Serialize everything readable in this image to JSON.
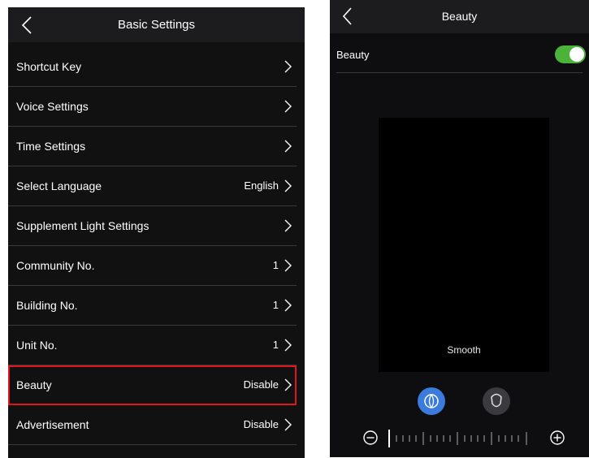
{
  "left_screen": {
    "header": {
      "title": "Basic Settings"
    },
    "items": [
      {
        "label": "Shortcut Key",
        "value": ""
      },
      {
        "label": "Voice Settings",
        "value": ""
      },
      {
        "label": "Time Settings",
        "value": ""
      },
      {
        "label": "Select Language",
        "value": "English"
      },
      {
        "label": "Supplement Light Settings",
        "value": ""
      },
      {
        "label": "Community No.",
        "value": "1"
      },
      {
        "label": "Building No.",
        "value": "1"
      },
      {
        "label": "Unit No.",
        "value": "1"
      },
      {
        "label": "Beauty",
        "value": "Disable",
        "highlighted": true
      },
      {
        "label": "Advertisement",
        "value": "Disable"
      }
    ]
  },
  "right_screen": {
    "header": {
      "title": "Beauty"
    },
    "toggle": {
      "label": "Beauty",
      "state": "on"
    },
    "preview": {
      "caption": "Smooth"
    },
    "modes": [
      {
        "icon": "smooth-mode-icon",
        "selected": true
      },
      {
        "icon": "face-shape-icon",
        "selected": false
      }
    ],
    "slider": {
      "level": 0.0
    }
  },
  "colors": {
    "background": "#111112",
    "header": "#1c1c1f",
    "highlight_border": "#e0141b",
    "toggle_on": "#4cb33a",
    "mode_selected": "#3a7bdc"
  }
}
